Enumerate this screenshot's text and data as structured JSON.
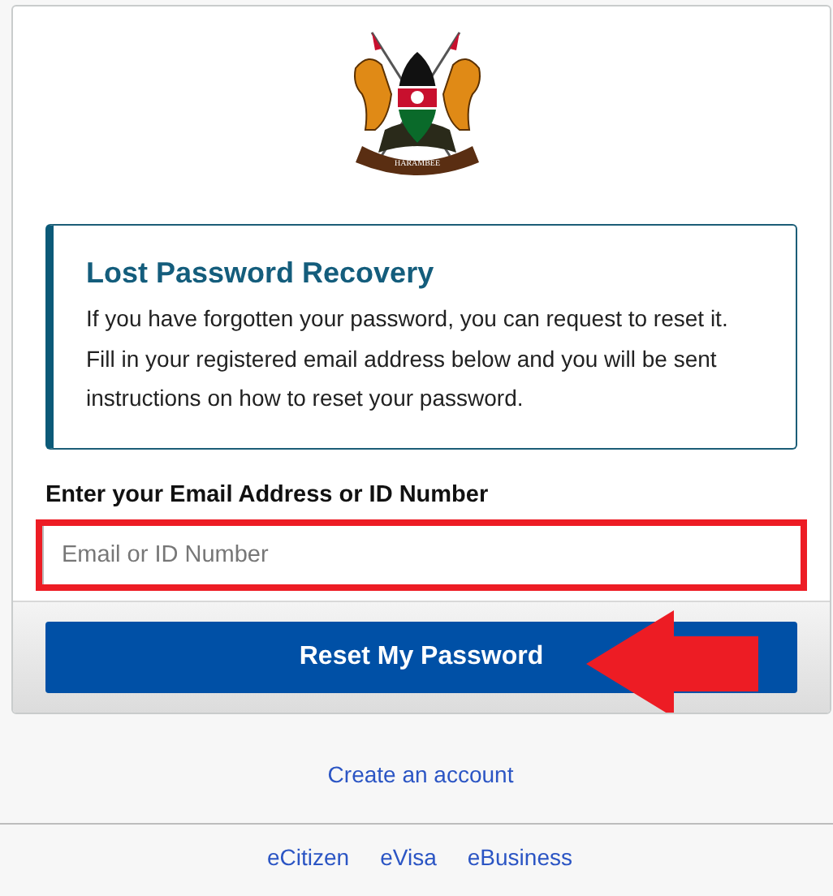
{
  "emblem": {
    "motto": "HARAMBEE"
  },
  "notice": {
    "title": "Lost Password Recovery",
    "text": "If you have forgotten your password, you can request to reset it. Fill in your registered email address below and you will be sent instructions on how to reset your password."
  },
  "field": {
    "label": "Enter your Email Address or ID Number",
    "placeholder": "Email or ID Number",
    "highlighted": true
  },
  "submit": {
    "label": "Reset My Password",
    "pointer": true
  },
  "create_account": "Create an account",
  "footer_links": [
    "eCitizen",
    "eVisa",
    "eBusiness"
  ]
}
